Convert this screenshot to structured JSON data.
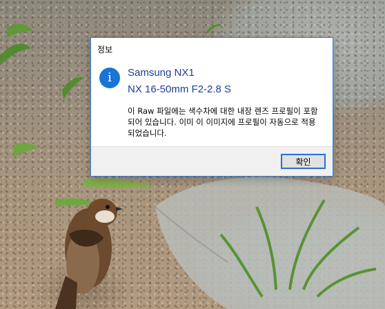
{
  "dialog": {
    "title": "정보",
    "icon": "info-icon",
    "heading_line1": "Samsung NX1",
    "heading_line2": "NX 16-50mm F2-2.8 S",
    "message": "이 Raw 파일에는 색수차에 대한 내장 렌즈 프로필이 포함되어 있습니다. 이미 이 이미지에 프로필이 자동으로 적용되었습니다.",
    "ok_label": "확인"
  },
  "colors": {
    "accent": "#1a74d6",
    "heading": "#1c3f94",
    "dialog_border": "#3d86d4"
  }
}
